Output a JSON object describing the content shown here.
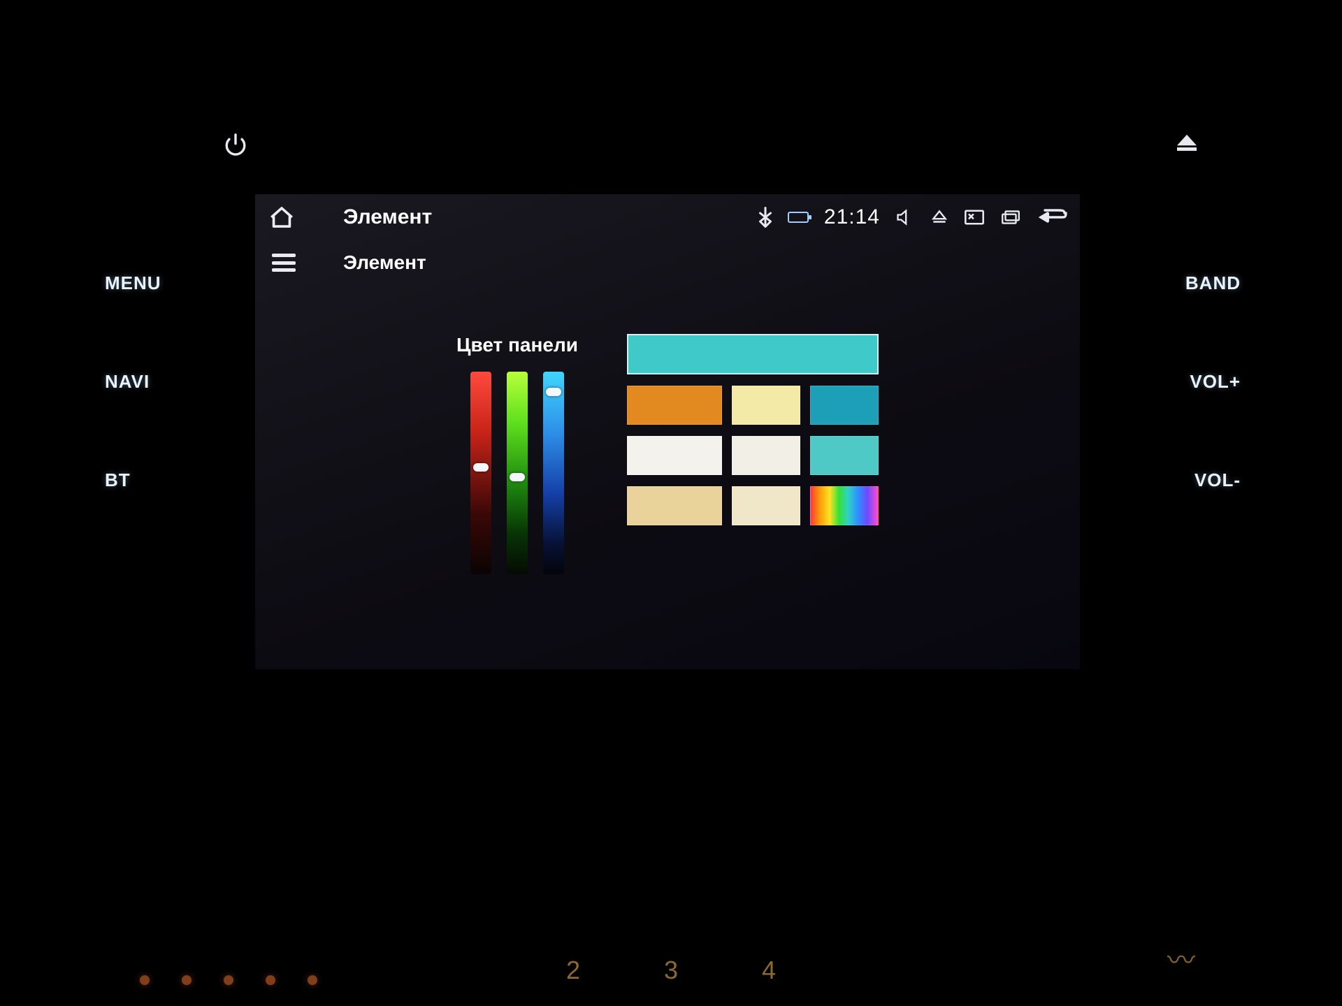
{
  "hardware": {
    "left_buttons": [
      "MENU",
      "NAVI",
      "BT"
    ],
    "right_buttons": [
      "BAND",
      "VOL+",
      "VOL-"
    ],
    "dash_numbers": [
      "2",
      "3",
      "4"
    ]
  },
  "statusbar": {
    "title": "Элемент",
    "time": "21:14"
  },
  "subbar": {
    "title": "Элемент"
  },
  "panel": {
    "sliders_label": "Цвет панели",
    "sliders": {
      "red": {
        "thumb_pct": 45
      },
      "green": {
        "thumb_pct": 50
      },
      "blue": {
        "thumb_pct": 8
      }
    },
    "preview_color": "#3fc9c9",
    "swatches": [
      [
        "#e28a1f",
        "#f2eaa6",
        "#1e9fb8"
      ],
      [
        "#f4f2ed",
        "#f2efe7",
        "#4fc9c6"
      ],
      [
        "#e9d39a",
        "#f0e7c8",
        "rainbow"
      ]
    ]
  }
}
